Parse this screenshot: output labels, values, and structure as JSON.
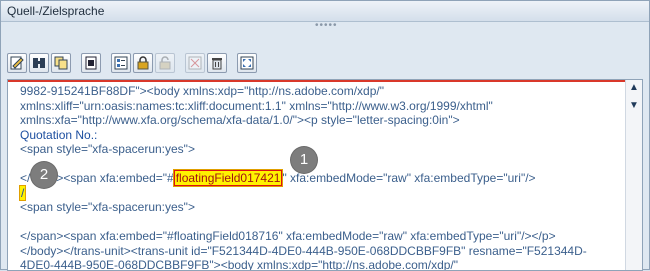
{
  "panel": {
    "title": "Quell-/Zielsprache"
  },
  "toolbar": {
    "buttons": [
      {
        "name": "edit-icon"
      },
      {
        "name": "find-binoculars-icon"
      },
      {
        "name": "copy-icon"
      },
      {
        "name": "insert-icon"
      },
      {
        "name": "list-icon"
      },
      {
        "name": "lock-icon"
      },
      {
        "name": "unlock-icon"
      },
      {
        "name": "cross-out-icon"
      },
      {
        "name": "delete-bin-icon"
      },
      {
        "name": "fullscreen-icon"
      }
    ]
  },
  "editor": {
    "lines": {
      "l1": "9982-915241BF88DF\"><body xmlns:xdp=\"http://ns.adobe.com/xdp/\"",
      "l2": "xmlns:xliff=\"urn:oasis:names:tc:xliff:document:1.1\" xmlns=\"http://www.w3.org/1999/xhtml\"",
      "l3": "xmlns:xfa=\"http://www.xfa.org/schema/xfa-data/1.0/\"><p style=\"letter-spacing:0in\">",
      "l4": "Quotation No.:",
      "l5": "<span style=\"xfa-spacerun:yes\">",
      "l7a": "</",
      "l7b": "><span xfa:embed=\"#",
      "l7c": "floatingField017421",
      "l7d": "\" xfa:embedMode=\"raw\" xfa:embedType=\"uri\"/>",
      "l8": "/",
      "l9": "<span style=\"xfa-spacerun:yes\">",
      "l11": "</span><span xfa:embed=\"#floatingField018716\" xfa:embedMode=\"raw\" xfa:embedType=\"uri\"/></p>",
      "l12": "</body></trans-unit><trans-unit id=\"F521344D-4DE0-444B-950E-068DDCBBF9FB\" resname=\"F521344D-",
      "l13": "4DE0-444B-950E-068DDCBBF9FB\"><body xmlns:xdp=\"http://ns.adobe.com/xdp/\""
    }
  },
  "markers": {
    "one": "1",
    "two": "2"
  },
  "scroll": {
    "up": "▲",
    "down": "▼"
  }
}
